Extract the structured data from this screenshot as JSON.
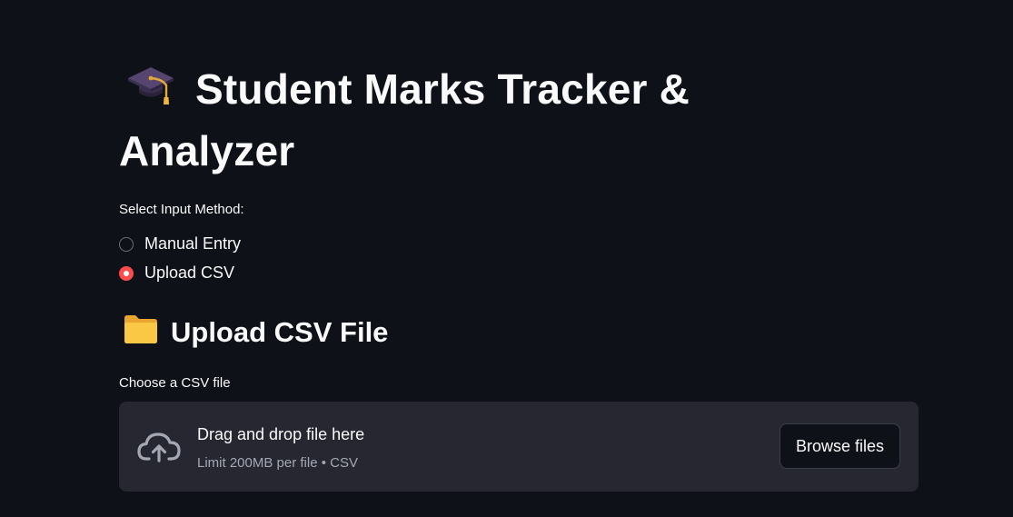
{
  "header": {
    "title": "Student Marks Tracker & Analyzer",
    "title_icon": "graduation-cap-icon"
  },
  "input_method": {
    "label": "Select Input Method:",
    "options": [
      {
        "label": "Manual Entry",
        "selected": false
      },
      {
        "label": "Upload CSV",
        "selected": true
      }
    ]
  },
  "upload_section": {
    "heading": "Upload CSV File",
    "heading_icon": "folder-icon",
    "file_label": "Choose a CSV file",
    "dropzone": {
      "icon": "cloud-upload-icon",
      "title": "Drag and drop file here",
      "subtitle": "Limit 200MB per file • CSV",
      "button_label": "Browse files"
    }
  },
  "colors": {
    "background": "#0e1117",
    "accent": "#ff4b4b",
    "dropzone_bg": "#262730",
    "muted_text": "#a3a8b4"
  }
}
